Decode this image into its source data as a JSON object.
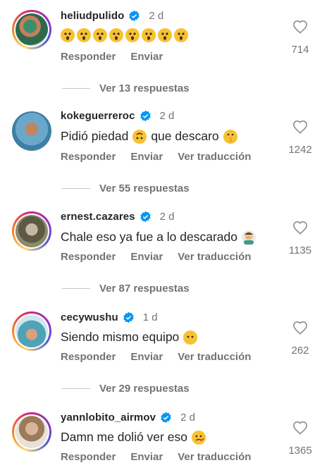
{
  "comments": [
    {
      "username": "heliudpulido",
      "time": "2 d",
      "text": "",
      "emoji_count": 8,
      "actions": [
        "Responder",
        "Enviar"
      ],
      "likes": "714"
    },
    {
      "username": "kokeguerreroc",
      "time": "2 d",
      "text_part1": "Pidió piedad",
      "text_part2": "que descaro",
      "actions": [
        "Responder",
        "Enviar",
        "Ver traducción"
      ],
      "likes": "1242"
    },
    {
      "username": "ernest.cazares",
      "time": "2 d",
      "text": "Chale eso ya fue a lo descarado",
      "actions": [
        "Responder",
        "Enviar",
        "Ver traducción"
      ],
      "likes": "1135"
    },
    {
      "username": "cecywushu",
      "time": "1 d",
      "text": "Siendo mismo equipo",
      "actions": [
        "Responder",
        "Enviar",
        "Ver traducción"
      ],
      "likes": "262"
    },
    {
      "username": "yannlobito_airmov",
      "time": "2 d",
      "text": "Damn me dolió ver eso",
      "actions": [
        "Responder",
        "Enviar",
        "Ver traducción"
      ],
      "likes": "1365"
    }
  ],
  "replies": [
    "Ver 13 respuestas",
    "Ver 55 respuestas",
    "Ver 87 respuestas",
    "Ver 29 respuestas"
  ],
  "colors": {
    "verified": "#0095f6",
    "secondary_text": "#737373",
    "primary_text": "#262626"
  },
  "icons": {
    "verified": "verified-badge-icon",
    "like": "heart-outline-icon"
  }
}
